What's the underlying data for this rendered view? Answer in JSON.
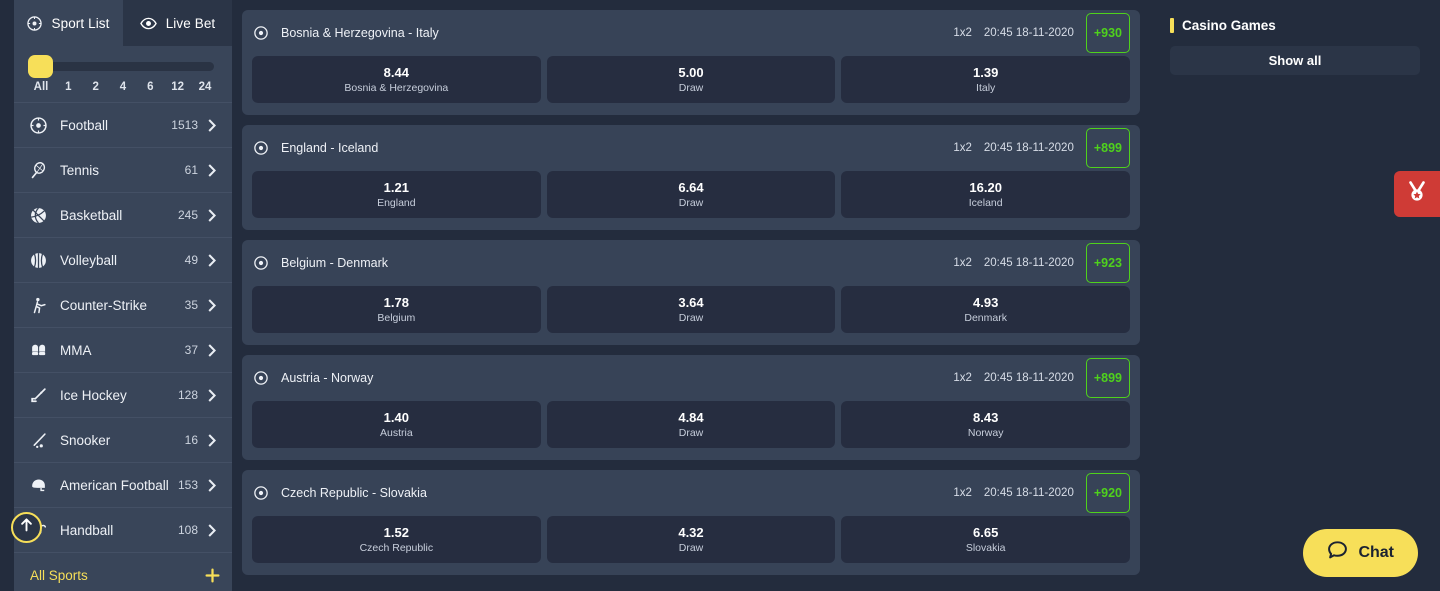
{
  "sidebar": {
    "tabs": [
      {
        "label": "Sport List",
        "icon": "football-icon",
        "active": true
      },
      {
        "label": "Live Bet",
        "icon": "eye-icon",
        "active": false
      }
    ],
    "time_filter": {
      "selected": "All",
      "options": [
        "All",
        "1",
        "2",
        "4",
        "6",
        "12",
        "24"
      ]
    },
    "sports": [
      {
        "name": "Football",
        "count": "1513",
        "icon": "football-icon"
      },
      {
        "name": "Tennis",
        "count": "61",
        "icon": "tennis-racket-icon"
      },
      {
        "name": "Basketball",
        "count": "245",
        "icon": "basketball-icon"
      },
      {
        "name": "Volleyball",
        "count": "49",
        "icon": "volleyball-icon"
      },
      {
        "name": "Counter-Strike",
        "count": "35",
        "icon": "counter-strike-icon"
      },
      {
        "name": "MMA",
        "count": "37",
        "icon": "mma-gloves-icon"
      },
      {
        "name": "Ice Hockey",
        "count": "128",
        "icon": "hockey-stick-icon"
      },
      {
        "name": "Snooker",
        "count": "16",
        "icon": "snooker-cue-icon"
      },
      {
        "name": "American Football",
        "count": "153",
        "icon": "helmet-icon"
      },
      {
        "name": "Handball",
        "count": "108",
        "icon": "handball-icon"
      }
    ],
    "all_sports": {
      "label": "All Sports",
      "icon": "plus-icon"
    },
    "scroll_top": {
      "icon": "arrow-up-icon"
    }
  },
  "matches": [
    {
      "title": "Bosnia & Herzegovina - Italy",
      "market": "1x2",
      "time": "20:45 18-11-2020",
      "more": "+930",
      "odds": [
        {
          "value": "8.44",
          "name": "Bosnia & Herzegovina"
        },
        {
          "value": "5.00",
          "name": "Draw"
        },
        {
          "value": "1.39",
          "name": "Italy"
        }
      ]
    },
    {
      "title": "England - Iceland",
      "market": "1x2",
      "time": "20:45 18-11-2020",
      "more": "+899",
      "odds": [
        {
          "value": "1.21",
          "name": "England"
        },
        {
          "value": "6.64",
          "name": "Draw"
        },
        {
          "value": "16.20",
          "name": "Iceland"
        }
      ]
    },
    {
      "title": "Belgium - Denmark",
      "market": "1x2",
      "time": "20:45 18-11-2020",
      "more": "+923",
      "odds": [
        {
          "value": "1.78",
          "name": "Belgium"
        },
        {
          "value": "3.64",
          "name": "Draw"
        },
        {
          "value": "4.93",
          "name": "Denmark"
        }
      ]
    },
    {
      "title": "Austria - Norway",
      "market": "1x2",
      "time": "20:45 18-11-2020",
      "more": "+899",
      "odds": [
        {
          "value": "1.40",
          "name": "Austria"
        },
        {
          "value": "4.84",
          "name": "Draw"
        },
        {
          "value": "8.43",
          "name": "Norway"
        }
      ]
    },
    {
      "title": "Czech Republic - Slovakia",
      "market": "1x2",
      "time": "20:45 18-11-2020",
      "more": "+920",
      "odds": [
        {
          "value": "1.52",
          "name": "Czech Republic"
        },
        {
          "value": "4.32",
          "name": "Draw"
        },
        {
          "value": "6.65",
          "name": "Slovakia"
        }
      ]
    }
  ],
  "rail": {
    "title": "Casino Games",
    "show_all": "Show all"
  },
  "promo_tab": {
    "icon": "medal-icon"
  },
  "chat": {
    "label": "Chat",
    "icon": "chat-bubble-icon"
  },
  "colors": {
    "page_bg": "#232c3d",
    "panel_bg": "#394559",
    "row_bg": "#374357",
    "odd_bg": "#262d40",
    "accent_yellow": "#f7df59",
    "accent_green": "#4fd21c",
    "promo_red": "#cf3b36"
  }
}
